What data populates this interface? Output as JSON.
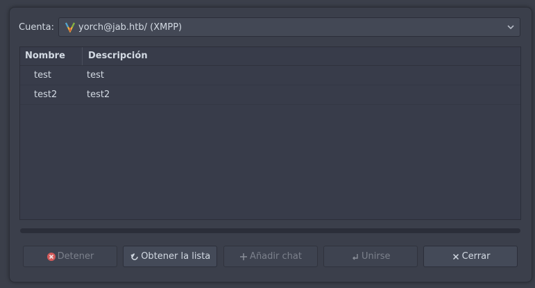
{
  "account": {
    "label": "Cuenta:",
    "value": "yorch@jab.htb/ (XMPP)",
    "icon": "xmpp-bulb-icon"
  },
  "list": {
    "columns": [
      "Nombre",
      "Descripción"
    ],
    "rows": [
      {
        "name": "test",
        "description": "test"
      },
      {
        "name": "test2",
        "description": "test2"
      }
    ]
  },
  "buttons": {
    "stop": {
      "label": "Detener",
      "icon": "stop-icon",
      "enabled": false
    },
    "get_list": {
      "label": "Obtener la lista",
      "icon": "refresh-icon",
      "enabled": true
    },
    "add_chat": {
      "label": "Añadir chat",
      "icon": "add-icon",
      "enabled": false
    },
    "join": {
      "label": "Unirse",
      "icon": "join-icon",
      "enabled": false
    },
    "close": {
      "label": "Cerrar",
      "icon": "close-icon",
      "enabled": true
    }
  }
}
